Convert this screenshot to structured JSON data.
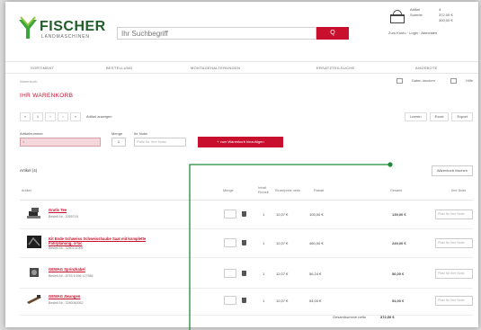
{
  "header": {
    "logo_text": "FISCHER",
    "logo_sub": "LANDMASCHINEN",
    "search_placeholder": "Ihr Suchbegriff",
    "search_button": "Q",
    "cart": {
      "line1_label": "Artikel",
      "line1_value": "4",
      "line2_label": "Summe",
      "line2_value": "372,00 €",
      "line3_value": "300,00 €",
      "links": "Zum Konto · Login · Abmelden"
    }
  },
  "nav": [
    "SORTIMENT",
    "BESTELLUNG",
    "MONTAGEHALTERUNGEN",
    "ERSATZTEILSUCHE",
    "ANGEBOTE"
  ],
  "breadcrumb": "Warenkorb",
  "tools": {
    "print": "Daten drucken",
    "help": "Hilfe"
  },
  "page_title": "IHR WARENKORB",
  "pager": {
    "pages": [
      "«",
      "1",
      "‹",
      "›",
      "»"
    ],
    "text": "Artikel anzeigen"
  },
  "right_buttons": [
    "Leeren",
    "Excel",
    "Export"
  ],
  "form": {
    "art_label": "Artikelnummer",
    "qty_label": "Menge",
    "note_label": "Ihr Notiz",
    "art_value": "1",
    "qty_value": "1",
    "note_placeholder": "Platz für Ihre Notiz",
    "add_button": "+ zum Warenkorb hinzufügen"
  },
  "count_text": "Artikel (4)",
  "delete_button": "Warenkorb löschen",
  "columns": [
    "Artikel",
    "Menge",
    "Inhalt Einheit",
    "Einzelpreis netto",
    "Rabatt",
    "Gesamt",
    "Ihre Notiz"
  ],
  "items": [
    {
      "name": "Gratis Tee",
      "number": "Bestell-Nr.: 2055718",
      "unit": "1",
      "price": "12,07 €",
      "discount": "105,00 €",
      "total": "139,00 €",
      "note": "Platz für Ihre Notiz"
    },
    {
      "name": "Kit Ende Schweiss Schweisshaube Saat mit komplette Fahrplanung, 4-fac",
      "number": "Bestell-Nr.: 3280141006",
      "unit": "1",
      "price": "12,07 €",
      "discount": "460,00 €",
      "total": "249,00 €",
      "note": "Platz für Ihre Notiz"
    },
    {
      "name": "GEWAG Sprinzkabel",
      "number": "Bestell-Nr.: 8793 6 596 127586",
      "unit": "1",
      "price": "12,07 €",
      "discount": "56,24 €",
      "total": "56,00 €",
      "note": "Platz für Ihre Notiz"
    },
    {
      "name": "GEWAG Zwangen",
      "number": "Bestell-Nr.: 3280060052",
      "unit": "1",
      "price": "12,07 €",
      "discount": "54,00 €",
      "total": "54,00 €",
      "note": "Platz für Ihre Notiz"
    }
  ],
  "total": {
    "label": "Gesamtsumme netto",
    "value": "372,00 €"
  },
  "colors": {
    "brand_red": "#c8102e",
    "brand_green": "#3aa63a",
    "annotation_green": "#1e8a3c"
  },
  "icons": [
    "logo-leaf-icon",
    "basket-icon",
    "search-icon",
    "trash-icon",
    "product-thumbnail"
  ]
}
